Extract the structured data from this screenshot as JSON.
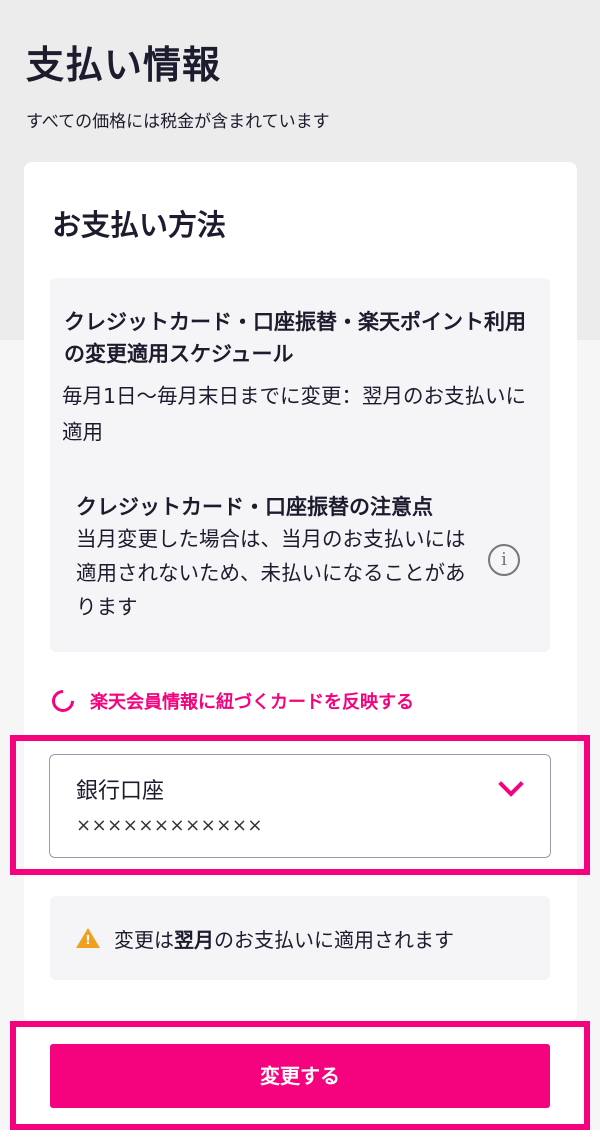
{
  "header": {
    "title": "支払い情報",
    "subtitle": "すべての価格には税金が含まれています"
  },
  "payment": {
    "section_title": "お支払い方法",
    "schedule": {
      "title": "クレジットカード・口座振替・楽天ポイント利用の変更適用スケジュール",
      "body": "毎月1日〜毎月末日までに変更：翌月のお支払いに適用"
    },
    "notice": {
      "title": "クレジットカード・口座振替の注意点",
      "body": "当月変更した場合は、当月のお支払いには適用されないため、未払いになることがあります",
      "info_icon": "info-icon"
    },
    "sync_link": {
      "label": "楽天会員情報に紐づくカードを反映する",
      "icon": "refresh-icon"
    },
    "method_select": {
      "value": "銀行口座",
      "account": "××××××××××××",
      "icon": "chevron-down-icon"
    },
    "warning": {
      "prefix": "変更は",
      "emphasis": "翌月",
      "suffix": "のお支払いに適用されます",
      "icon": "warning-icon"
    },
    "submit_label": "変更する"
  },
  "colors": {
    "accent": "#f5037f",
    "warning": "#f0a020",
    "text": "#1c1c2e"
  }
}
